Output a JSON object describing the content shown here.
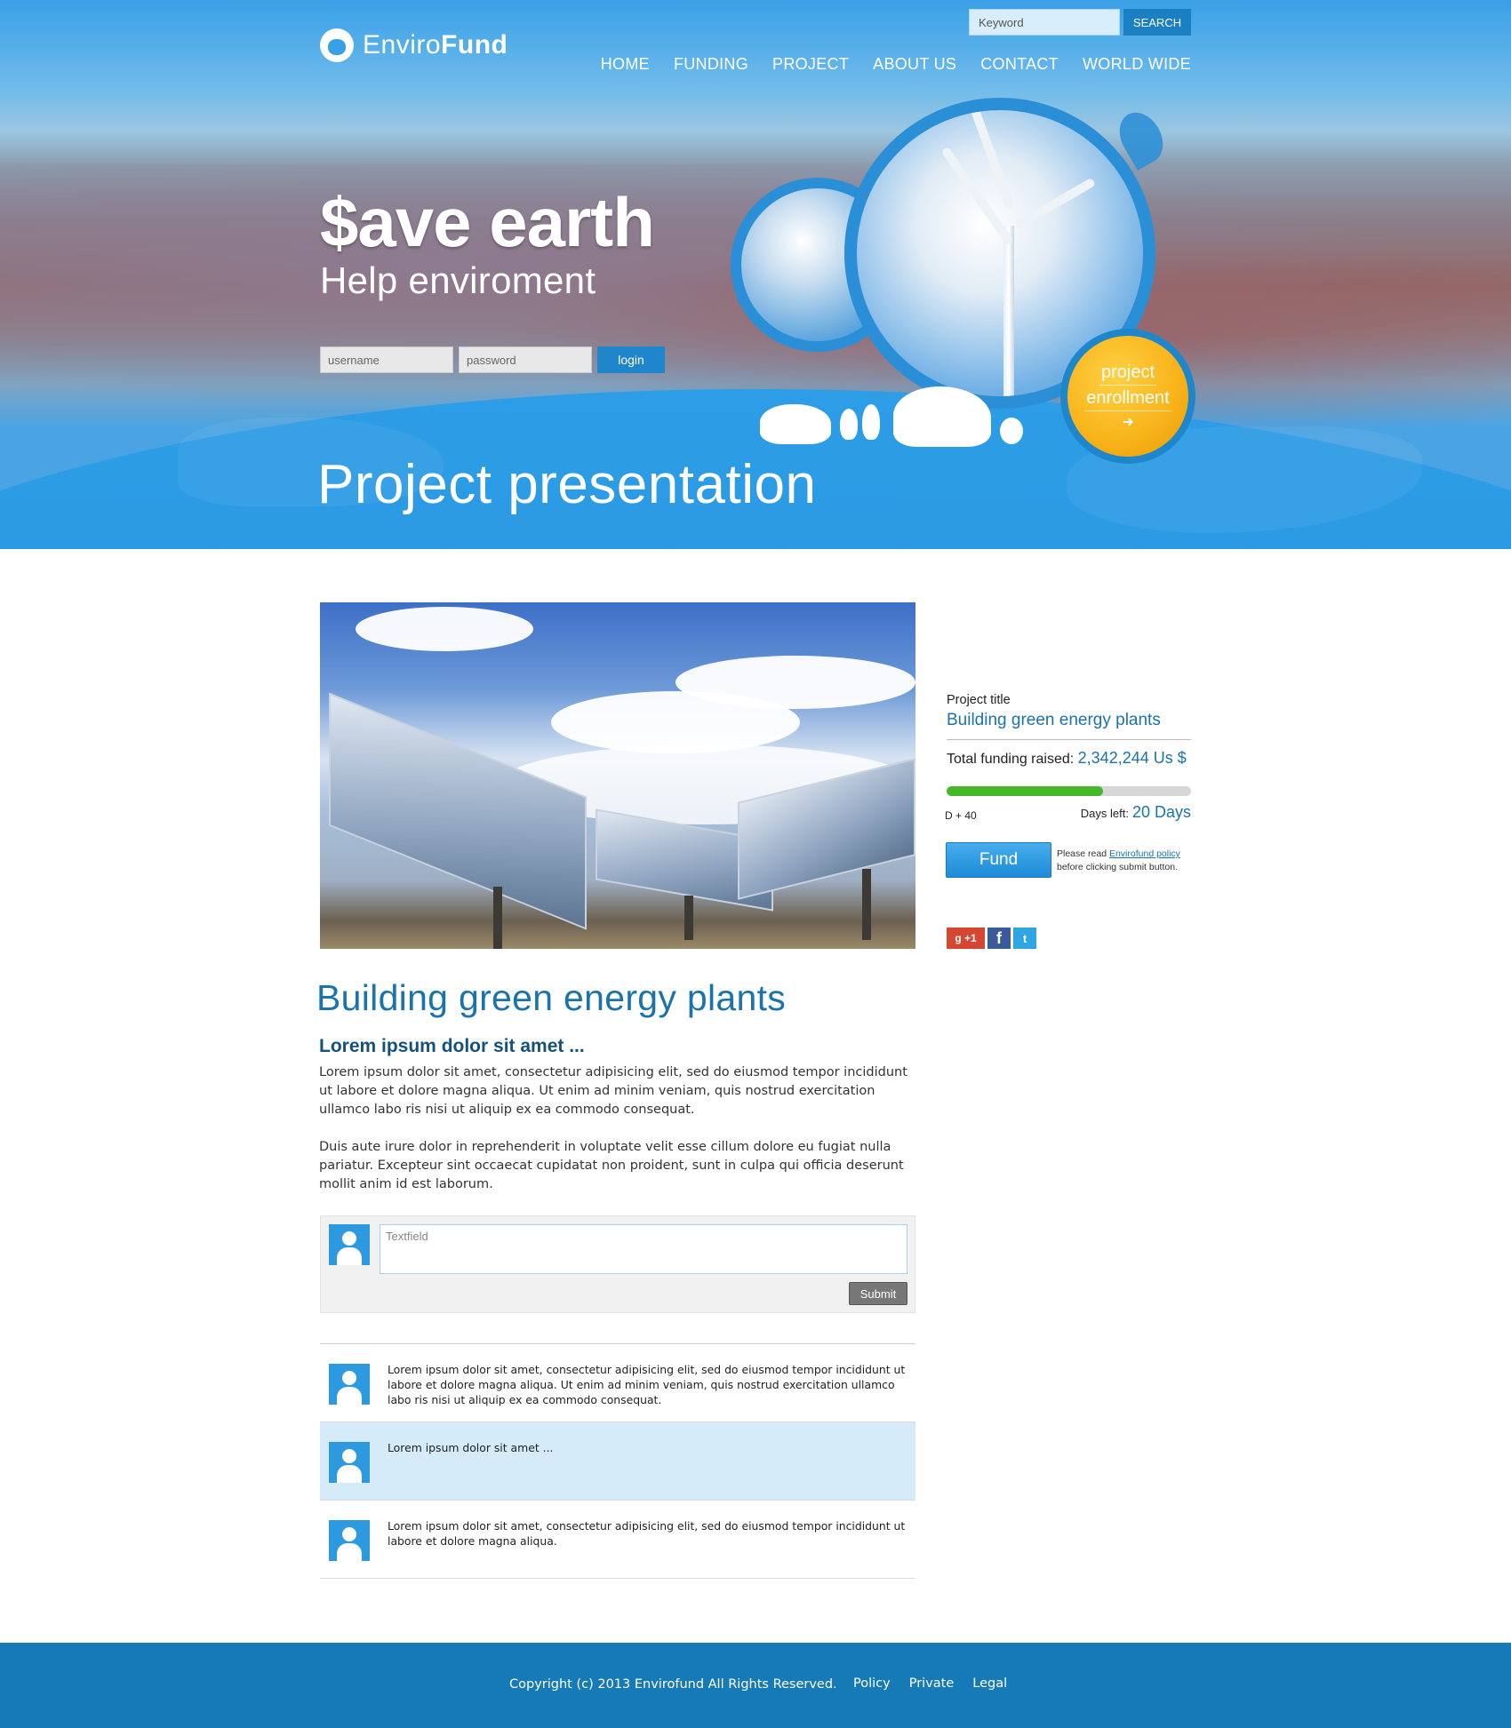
{
  "brand": {
    "name_light": "Enviro",
    "name_bold": "Fund",
    "logo_icon": "globe-icon"
  },
  "search": {
    "placeholder": "Keyword",
    "button_label": "SEARCH"
  },
  "nav": {
    "items": [
      {
        "label": "HOME"
      },
      {
        "label": "FUNDING"
      },
      {
        "label": "PROJECT"
      },
      {
        "label": "ABOUT US"
      },
      {
        "label": "CONTACT"
      },
      {
        "label": "WORLD WIDE"
      }
    ]
  },
  "hero": {
    "headline": "$ave earth",
    "subline": "Help enviroment",
    "username_placeholder": "username",
    "password_placeholder": "password",
    "login_label": "login",
    "enroll_line1": "project",
    "enroll_line2": "enrollment",
    "enroll_arrow": "➜",
    "section_title": "Project presentation"
  },
  "article": {
    "title": "Building green energy plants",
    "subtitle": "Lorem ipsum dolor sit amet ...",
    "paragraphs": [
      "Lorem ipsum dolor sit amet, consectetur adipisicing elit, sed do eiusmod tempor incididunt ut labore et dolore magna aliqua. Ut enim ad minim veniam, quis nostrud exercitation ullamco labo ris nisi ut aliquip ex ea commodo consequat.",
      "Duis aute irure dolor in reprehenderit in voluptate velit esse cillum dolore eu fugiat nulla pariatur. Excepteur sint occaecat cupidatat non proident, sunt in culpa qui officia deserunt mollit anim id est laborum."
    ]
  },
  "comment_form": {
    "placeholder": "Textfield",
    "submit_label": "Submit"
  },
  "comments": [
    {
      "text": "Lorem ipsum dolor sit amet, consectetur adipisicing elit, sed do eiusmod tempor incididunt ut labore et dolore magna aliqua. Ut enim ad minim veniam, quis nostrud exercitation ullamco labo ris nisi ut aliquip ex ea commodo consequat.",
      "highlighted": false
    },
    {
      "text": "Lorem ipsum dolor sit amet ...",
      "highlighted": true
    },
    {
      "text": "Lorem ipsum dolor sit amet, consectetur adipisicing elit, sed do eiusmod tempor incididunt ut labore et dolore magna aliqua.",
      "highlighted": false
    }
  ],
  "sidebar": {
    "project_label": "Project title",
    "project_title": "Building green energy plants",
    "funding_label": "Total funding raised:",
    "funding_value": "2,342,244 Us $",
    "progress_fraction": 0.64,
    "day_counter": "D + 40",
    "days_left_label": "Days left:",
    "days_left_value": "20 Days",
    "fund_label": "Fund",
    "note_prefix": "Please read",
    "note_link": "Envirofund policy",
    "note_suffix": "before clicking submit button.",
    "social": [
      {
        "icon": "google-plus-icon",
        "label": "g +1"
      },
      {
        "icon": "facebook-icon",
        "label": "f"
      },
      {
        "icon": "twitter-icon",
        "label": "t"
      }
    ]
  },
  "footer": {
    "copyright": "Copyright (c) 2013 Envirofund All Rights Reserved.",
    "links": [
      {
        "label": "Policy"
      },
      {
        "label": "Private"
      },
      {
        "label": "Legal"
      }
    ]
  },
  "colors": {
    "brand_blue": "#2c9de6",
    "accent_orange": "#f8b319",
    "title_blue": "#1a73aa",
    "progress_green": "#45b82a",
    "footer_blue": "#157ab5"
  }
}
